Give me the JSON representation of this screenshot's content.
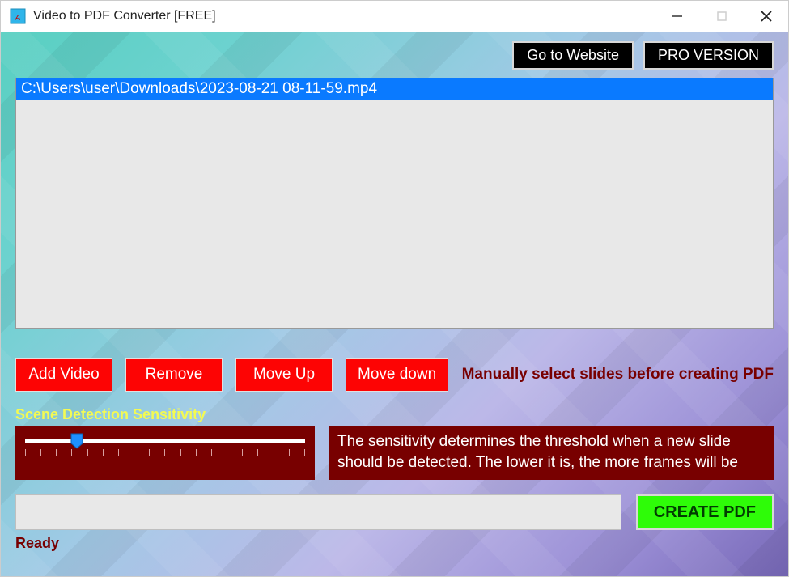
{
  "window": {
    "title": "Video to PDF Converter [FREE]"
  },
  "top_buttons": {
    "website": "Go to Website",
    "pro": "PRO VERSION"
  },
  "file_list": {
    "items": [
      "C:\\Users\\user\\Downloads\\2023-08-21 08-11-59.mp4"
    ]
  },
  "actions": {
    "add_video": "Add Video",
    "remove": "Remove",
    "move_up": "Move Up",
    "move_down": "Move down"
  },
  "manual_select_label": "Manually select slides before creating PDF",
  "sensitivity": {
    "label": "Scene Detection Sensitivity",
    "description": "The sensitivity determines the threshold when a new slide should be detected. The lower it is, the more frames will be"
  },
  "create_button": "CREATE PDF",
  "status": "Ready"
}
